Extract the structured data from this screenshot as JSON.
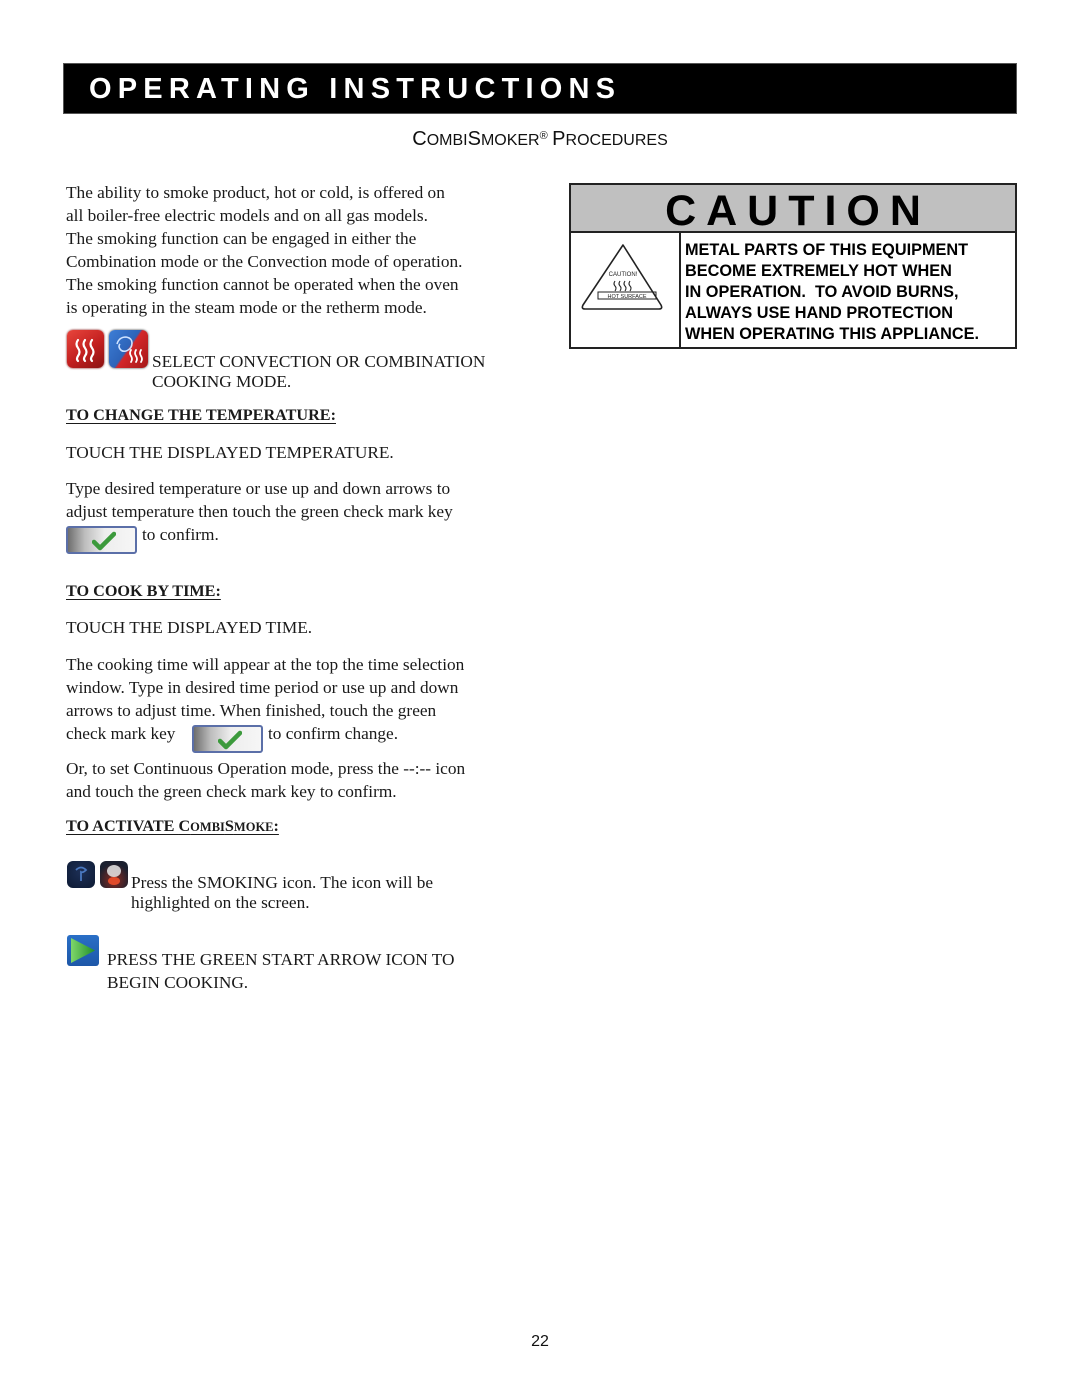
{
  "header": {
    "banner_title": "OPERATING INSTRUCTIONS",
    "subtitle": {
      "part1_big": "C",
      "part1_small": "OMBI",
      "part2_big": "S",
      "part2_small": "MOKER",
      "registered": "®",
      "part3_big": "P",
      "part3_small": "ROCEDURES"
    }
  },
  "intro": {
    "lines": [
      "The ability to smoke product, hot or cold, is offered on",
      "all boiler-free electric models and on all gas models.",
      "The smoking function can be engaged in either the",
      "Combination mode or the Convection mode of operation.",
      "The smoking function cannot be operated when the oven",
      "is operating in the steam mode or the retherm mode."
    ]
  },
  "select_mode": {
    "icons": [
      "convection-mode-icon",
      "combination-mode-icon"
    ],
    "line1": "SELECT CONVECTION OR COMBINATION",
    "line2": "COOKING MODE."
  },
  "temperature": {
    "heading": "TO CHANGE THE TEMPERATURE:",
    "instruction": "TOUCH THE DISPLAYED TEMPERATURE.",
    "line1": "Type desired temperature or use up and down arrows to",
    "line2": "adjust temperature then touch the green check mark key",
    "line3": "to confirm."
  },
  "time": {
    "heading": "TO COOK BY TIME:",
    "instruction": "TOUCH THE DISPLAYED TIME.",
    "line1": "The cooking time will appear at the top the time selection",
    "line2": "window. Type in desired time period or use up and down",
    "line3": "arrows to adjust time. When finished, touch the green",
    "line4_before": "check mark key",
    "line4_after": "to confirm change.",
    "continuous_line1": "Or, to set Continuous Operation mode, press the --:-- icon",
    "continuous_line2": "and touch the green check mark key to confirm."
  },
  "combismoke": {
    "heading_main": "TO ACTIVATE ",
    "heading_c": "C",
    "heading_ombi": "OMBI",
    "heading_s": "S",
    "heading_moke": "MOKE",
    "heading_colon": ":",
    "smoking_line1": "Press the SMOKING icon. The icon will be",
    "smoking_line2": "highlighted on the screen.",
    "start_line1": "PRESS THE GREEN START ARROW ICON TO",
    "start_line2": "BEGIN COOKING."
  },
  "caution": {
    "title": "CAUTION",
    "symbol_caption_top": "CAUTION!",
    "symbol_caption_bottom": "HOT SURFACE",
    "lines": [
      "METAL PARTS OF THIS EQUIPMENT",
      "BECOME EXTREMELY HOT WHEN",
      "IN OPERATION.  TO AVOID BURNS,",
      "ALWAYS USE HAND PROTECTION",
      "WHEN OPERATING THIS APPLIANCE."
    ]
  },
  "colors": {
    "banner_bg": "#000000",
    "caution_header_bg": "#c0c0c0",
    "check_green": "#3c9a3c",
    "start_blue": "#1d57a8"
  },
  "footer": {
    "page_number": "22"
  }
}
